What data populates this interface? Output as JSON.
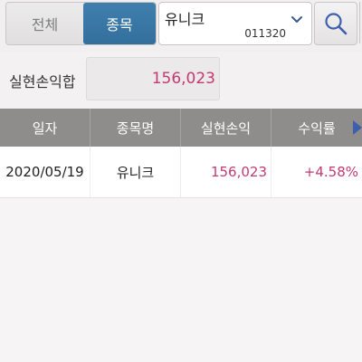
{
  "filter": {
    "tab_all": "전체",
    "tab_stock": "종목",
    "selected_stock_name": "유니크",
    "selected_stock_code": "011320"
  },
  "icons": {
    "dropdown": "chevron-down-icon",
    "search": "search-icon",
    "scroll_right": "triangle-right-icon"
  },
  "summary": {
    "label": "실현손익합",
    "value": "156,023"
  },
  "table": {
    "headers": [
      "일자",
      "종목명",
      "실현손익",
      "수익률"
    ],
    "rows": [
      {
        "date": "2020/05/19",
        "name": "유니크",
        "realized_pl": "156,023",
        "return_rate": "+4.58%"
      }
    ]
  },
  "colors": {
    "accent_blue": "#3a78a8",
    "profit_pink": "#c23a74",
    "header_gray": "#8f8c8c",
    "scroll_arrow": "#3e5fae"
  }
}
